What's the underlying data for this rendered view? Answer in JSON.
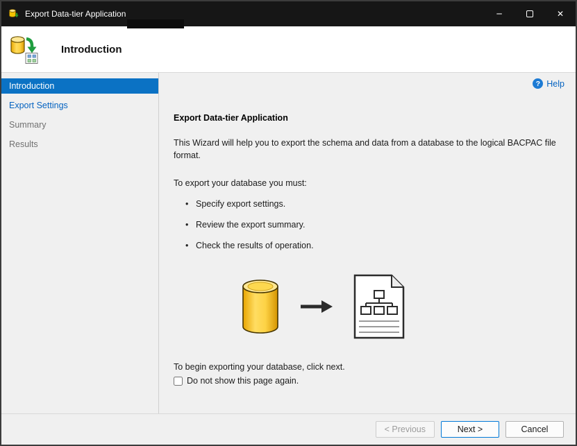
{
  "window": {
    "title": "Export Data-tier Application",
    "controls": {
      "minimize_glyph": "─",
      "close_glyph": "✕"
    }
  },
  "header": {
    "title": "Introduction"
  },
  "sidebar": {
    "items": [
      {
        "label": "Introduction",
        "state": "selected"
      },
      {
        "label": "Export Settings",
        "state": "enabled-link"
      },
      {
        "label": "Summary",
        "state": "disabled"
      },
      {
        "label": "Results",
        "state": "disabled"
      }
    ]
  },
  "content": {
    "help_label": "Help",
    "help_icon_glyph": "?",
    "heading": "Export Data-tier Application",
    "intro": "This Wizard will help you to export the schema and data from a database to the logical BACPAC file format.",
    "requirements_label": "To export your database you must:",
    "bullets": [
      "Specify export settings.",
      "Review the export summary.",
      "Check the results of operation."
    ],
    "begin_text": "To begin exporting your database, click next.",
    "checkbox_label": "Do not show this page again.",
    "checkbox_checked": false
  },
  "footer": {
    "previous_label": "< Previous",
    "previous_enabled": false,
    "next_label": "Next >",
    "cancel_label": "Cancel"
  },
  "colors": {
    "titlebar_bg": "#161616",
    "selected_nav_bg": "#0b72c4",
    "link_blue": "#0563c1",
    "accent_button_border": "#0078d7",
    "database_yellow": "#f6c62d"
  }
}
